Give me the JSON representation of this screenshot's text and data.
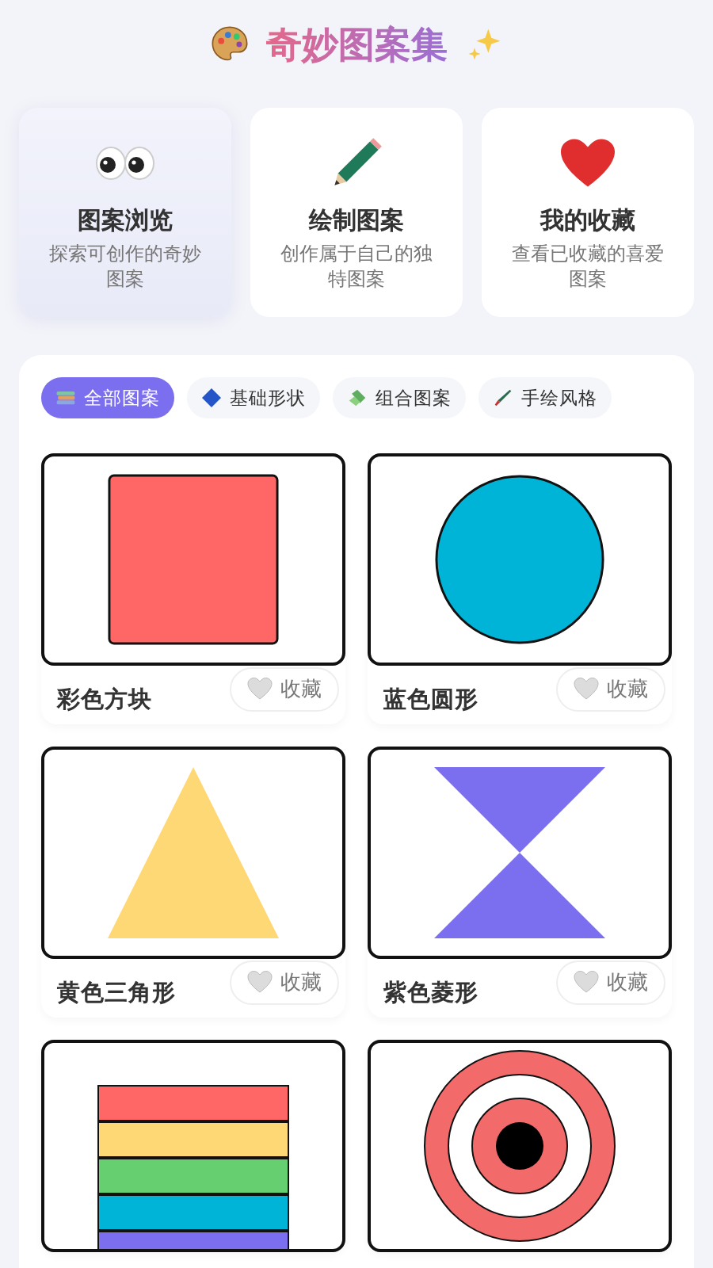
{
  "header": {
    "title": "奇妙图案集"
  },
  "features": [
    {
      "title": "图案浏览",
      "desc": "探索可创作的奇妙图案",
      "kind": "eyes",
      "selected": true
    },
    {
      "title": "绘制图案",
      "desc": "创作属于自己的独特图案",
      "kind": "pencil",
      "selected": false
    },
    {
      "title": "我的收藏",
      "desc": "查看已收藏的喜爱图案",
      "kind": "heart",
      "selected": false
    }
  ],
  "tabs": [
    {
      "label": "全部图案",
      "kind": "books",
      "selected": true
    },
    {
      "label": "基础形状",
      "kind": "diamond",
      "selected": false
    },
    {
      "label": "组合图案",
      "kind": "pills",
      "selected": false
    },
    {
      "label": "手绘风格",
      "kind": "brush",
      "selected": false
    }
  ],
  "patterns": [
    {
      "kind": "square",
      "title": "彩色方块",
      "favorite": {
        "label": "收藏",
        "favorited": false
      }
    },
    {
      "kind": "circle",
      "title": "蓝色圆形",
      "favorite": {
        "label": "收藏",
        "favorited": false
      }
    },
    {
      "kind": "triangle",
      "title": "黄色三角形",
      "favorite": {
        "label": "收藏",
        "favorited": false
      }
    },
    {
      "kind": "hourglass",
      "title": "紫色菱形",
      "favorite": {
        "label": "收藏",
        "favorited": false
      }
    },
    {
      "kind": "stripes"
    },
    {
      "kind": "target"
    }
  ]
}
